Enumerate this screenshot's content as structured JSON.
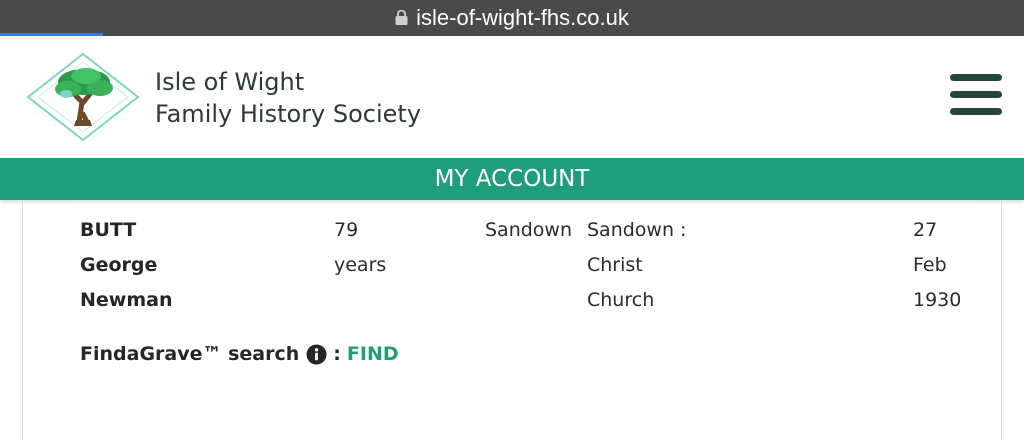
{
  "browser": {
    "url": "isle-of-wight-fhs.co.uk",
    "lock_icon": "lock-icon"
  },
  "header": {
    "site_name_line1": "Isle of Wight",
    "site_name_line2": "Family History Society",
    "logo_icon": "tree-logo-icon",
    "menu_icon": "hamburger-menu-icon"
  },
  "account_bar": {
    "label": "MY ACCOUNT"
  },
  "record": {
    "name": [
      "BUTT",
      "George",
      "Newman"
    ],
    "age": [
      "79",
      "years"
    ],
    "place": "Sandown",
    "church": [
      "Sandown :",
      "Christ",
      "Church"
    ],
    "date": [
      "27",
      "Feb",
      "1930"
    ]
  },
  "findagrave": {
    "label": "FindaGrave™ search",
    "separator": ":",
    "link_label": "FIND",
    "info_icon": "info-icon"
  },
  "colors": {
    "brand_green": "#1f9e7d",
    "header_dark_green": "#24463b",
    "url_bar": "#4a4a4a"
  }
}
